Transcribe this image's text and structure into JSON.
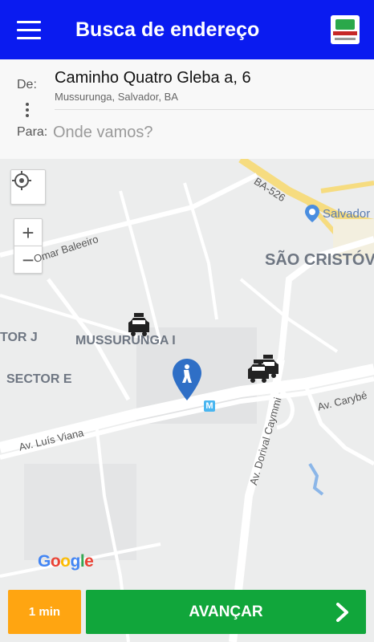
{
  "header": {
    "title": "Busca de endereço",
    "menu_icon": "hamburger-menu-icon",
    "logo_icon": "company-logo"
  },
  "address": {
    "from_label": "De:",
    "from_main": "Caminho Quatro Gleba a, 6",
    "from_sub": "Mussurunga, Salvador, BA",
    "to_label": "Para:",
    "to_placeholder": "Onde vamos?",
    "to_value": ""
  },
  "map": {
    "labels": {
      "mussurunga": "MUSSURUNGA I",
      "sector_e": "SECTOR E",
      "sector_j": "TOR J",
      "sao_cristovao": "SÃO CRISTÓV",
      "salvador": "Salvador"
    },
    "roads": {
      "ba526": "BA-526",
      "av_luis_viana": "Av. Luís Viana",
      "av_dorival": "Av. Dorival Caymmi",
      "av_carybe": "Av. Carybé",
      "omar_baleeiro": "Omar Baleeiro"
    },
    "metro_badge": "M",
    "google": [
      "G",
      "o",
      "o",
      "g",
      "l",
      "e"
    ],
    "controls": {
      "locate_icon": "crosshair-locate-icon",
      "zoom_in": "+",
      "zoom_out": "−"
    }
  },
  "footer": {
    "time_label": "1 min",
    "next_label": "AVANÇAR"
  },
  "colors": {
    "header": "#0a1bf0",
    "time_button": "#ffa511",
    "next_button": "#11a63b",
    "pin": "#2f6fc6"
  }
}
